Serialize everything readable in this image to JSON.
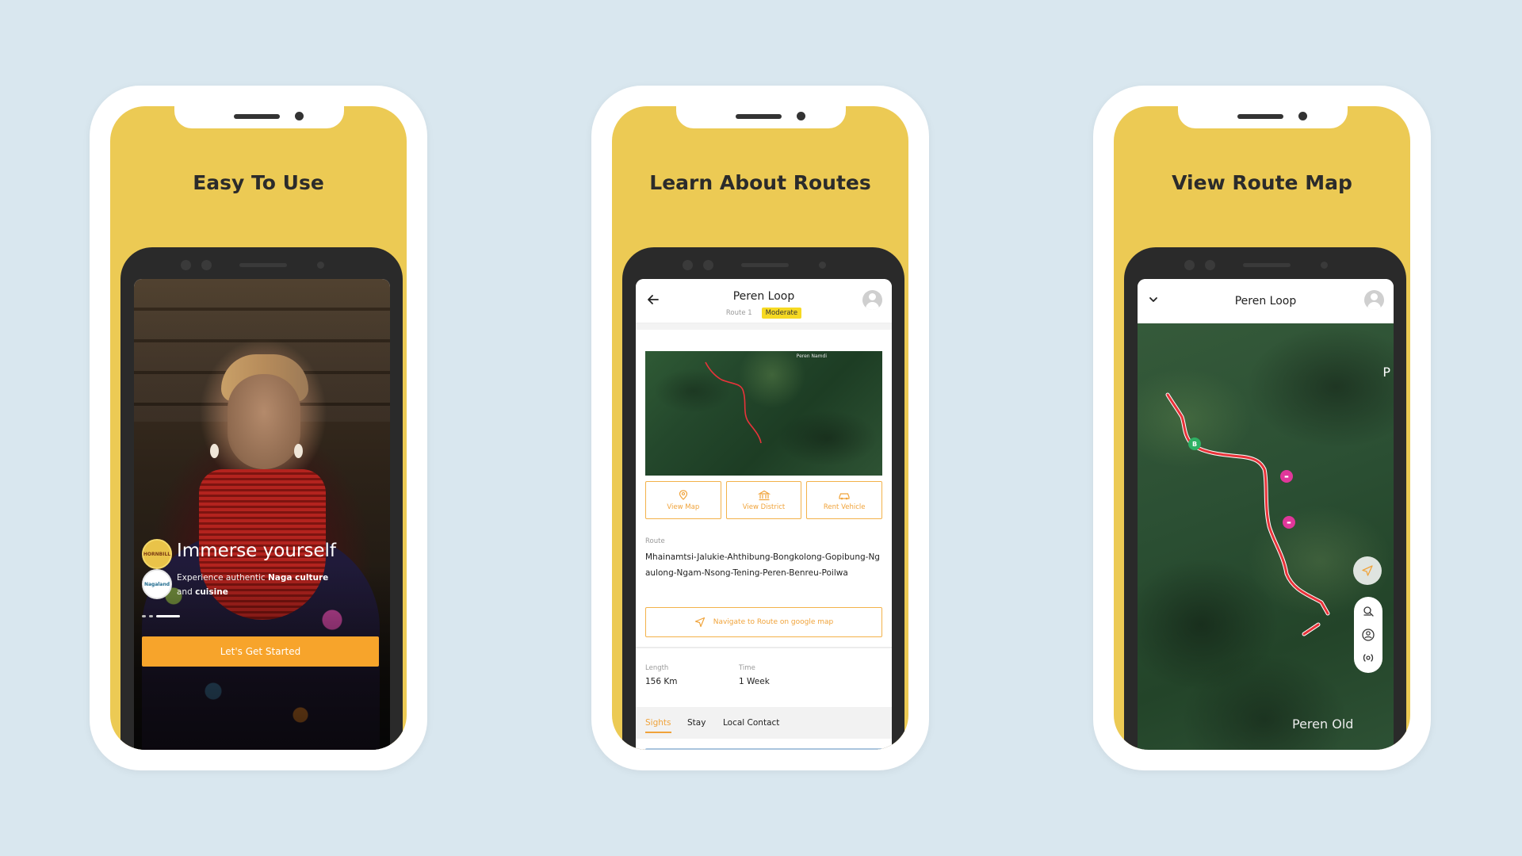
{
  "colors": {
    "background": "#d9e7ef",
    "panel_yellow": "#ecca54",
    "accent_orange": "#f7a42b",
    "moderate_badge": "#f6d923",
    "route_line": "#e8333a"
  },
  "panels": [
    {
      "title": "Easy To Use",
      "screen": {
        "headline": "Immerse yourself",
        "description_parts": [
          "Experience authentic ",
          "Naga culture",
          " and ",
          "cuisine"
        ],
        "badges": [
          "HORNBILL",
          "Nagaland"
        ],
        "cta_label": "Let's Get Started",
        "carousel": {
          "count": 3,
          "active_index": 2
        }
      }
    },
    {
      "title": "Learn About Routes",
      "screen": {
        "header_title": "Peren Loop",
        "route_number": "Route 1",
        "difficulty": "Moderate",
        "map_label": "Peren Namdi",
        "actions": [
          "View Map",
          "View District",
          "Rent Vehicle"
        ],
        "route_label": "Route",
        "route_text": "Mhainamtsi-Jalukie-Ahthibung-Bongkolong-Gopibung-Ngaulong-Ngam-Nsong-Tening-Peren-Benreu-Poilwa",
        "navigate_label": "Navigate to Route on google map",
        "length_label": "Length",
        "length_value": "156 Km",
        "time_label": "Time",
        "time_value": "1 Week",
        "tabs": [
          "Sights",
          "Stay",
          "Local Contact"
        ],
        "active_tab": "Sights"
      }
    },
    {
      "title": "View Route Map",
      "screen": {
        "header_title": "Peren Loop",
        "map_edge_letter": "P",
        "place_label": "Peren Old",
        "pins": [
          {
            "type": "green",
            "glyph": "B"
          },
          {
            "type": "hotel",
            "glyph": "▬"
          },
          {
            "type": "hotel",
            "glyph": "▬"
          }
        ],
        "tools": [
          "layers-icon",
          "user-location-icon",
          "broadcast-icon"
        ]
      }
    }
  ]
}
